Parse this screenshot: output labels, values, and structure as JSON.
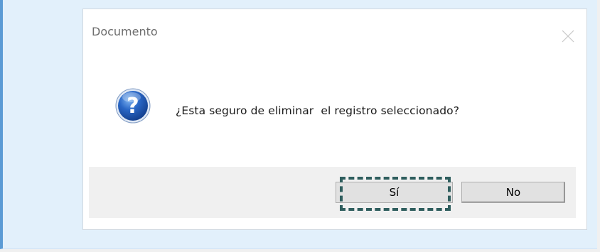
{
  "dialog": {
    "title": "Documento",
    "message": "¿Esta seguro de eliminar  el registro seleccionado?",
    "icon": "question-icon",
    "close_icon": "close-icon",
    "buttons": {
      "yes_label": "Sí",
      "no_label": "No"
    }
  },
  "colors": {
    "panel_background": "#e2f0fb",
    "panel_accent": "#5b9bd5",
    "dialog_background": "#ffffff",
    "button_strip": "#f0f0f0",
    "focus_ring": "#2f5e5e",
    "question_icon_blue": "#2a67c6"
  }
}
